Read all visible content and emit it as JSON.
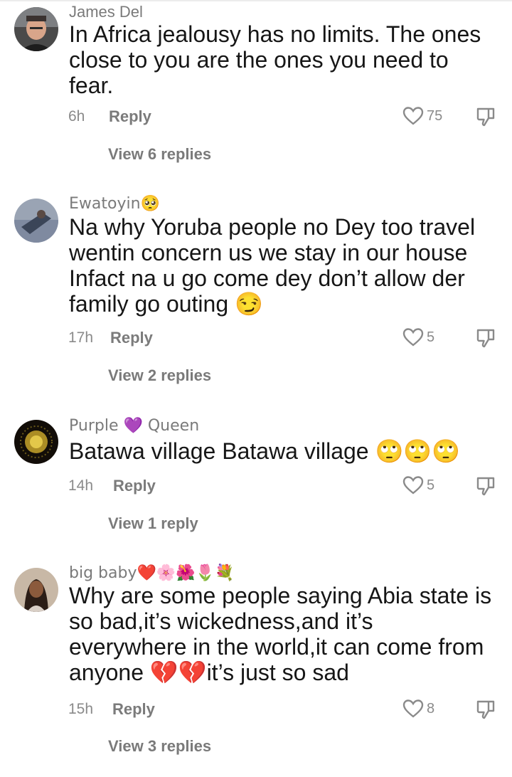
{
  "comments": [
    {
      "username": "James Del",
      "text": "In Africa jealousy has no limits. The ones close to you are the ones you need to fear.",
      "time": "6h",
      "reply_label": "Reply",
      "likes": "75",
      "view_replies": "View 6 replies"
    },
    {
      "username": "Ewatoyin🥺",
      "text": "Na why Yoruba people no Dey too travel wentin concern us we stay in our house Infact na u go come dey don’t allow der family go outing 😏",
      "time": "17h",
      "reply_label": "Reply",
      "likes": "5",
      "view_replies": "View 2 replies"
    },
    {
      "username": "Purple 💜 Queen",
      "text": "Batawa village Batawa village 🙄🙄🙄",
      "time": "14h",
      "reply_label": "Reply",
      "likes": "5",
      "view_replies": "View 1 reply"
    },
    {
      "username": "big baby❤️🌸🌺🌷💐",
      "text": "Why are some people saying Abia state is so bad,it’s wickedness,and it’s everywhere in the world,it can come from anyone 💔💔it’s just so sad",
      "time": "15h",
      "reply_label": "Reply",
      "likes": "8",
      "view_replies": "View 3 replies"
    }
  ],
  "icons": {
    "like": "heart-outline-icon",
    "dislike": "thumbs-down-outline-icon"
  },
  "colors": {
    "text": "#161616",
    "meta": "#8a8a8a",
    "username": "#7a7a7a"
  }
}
